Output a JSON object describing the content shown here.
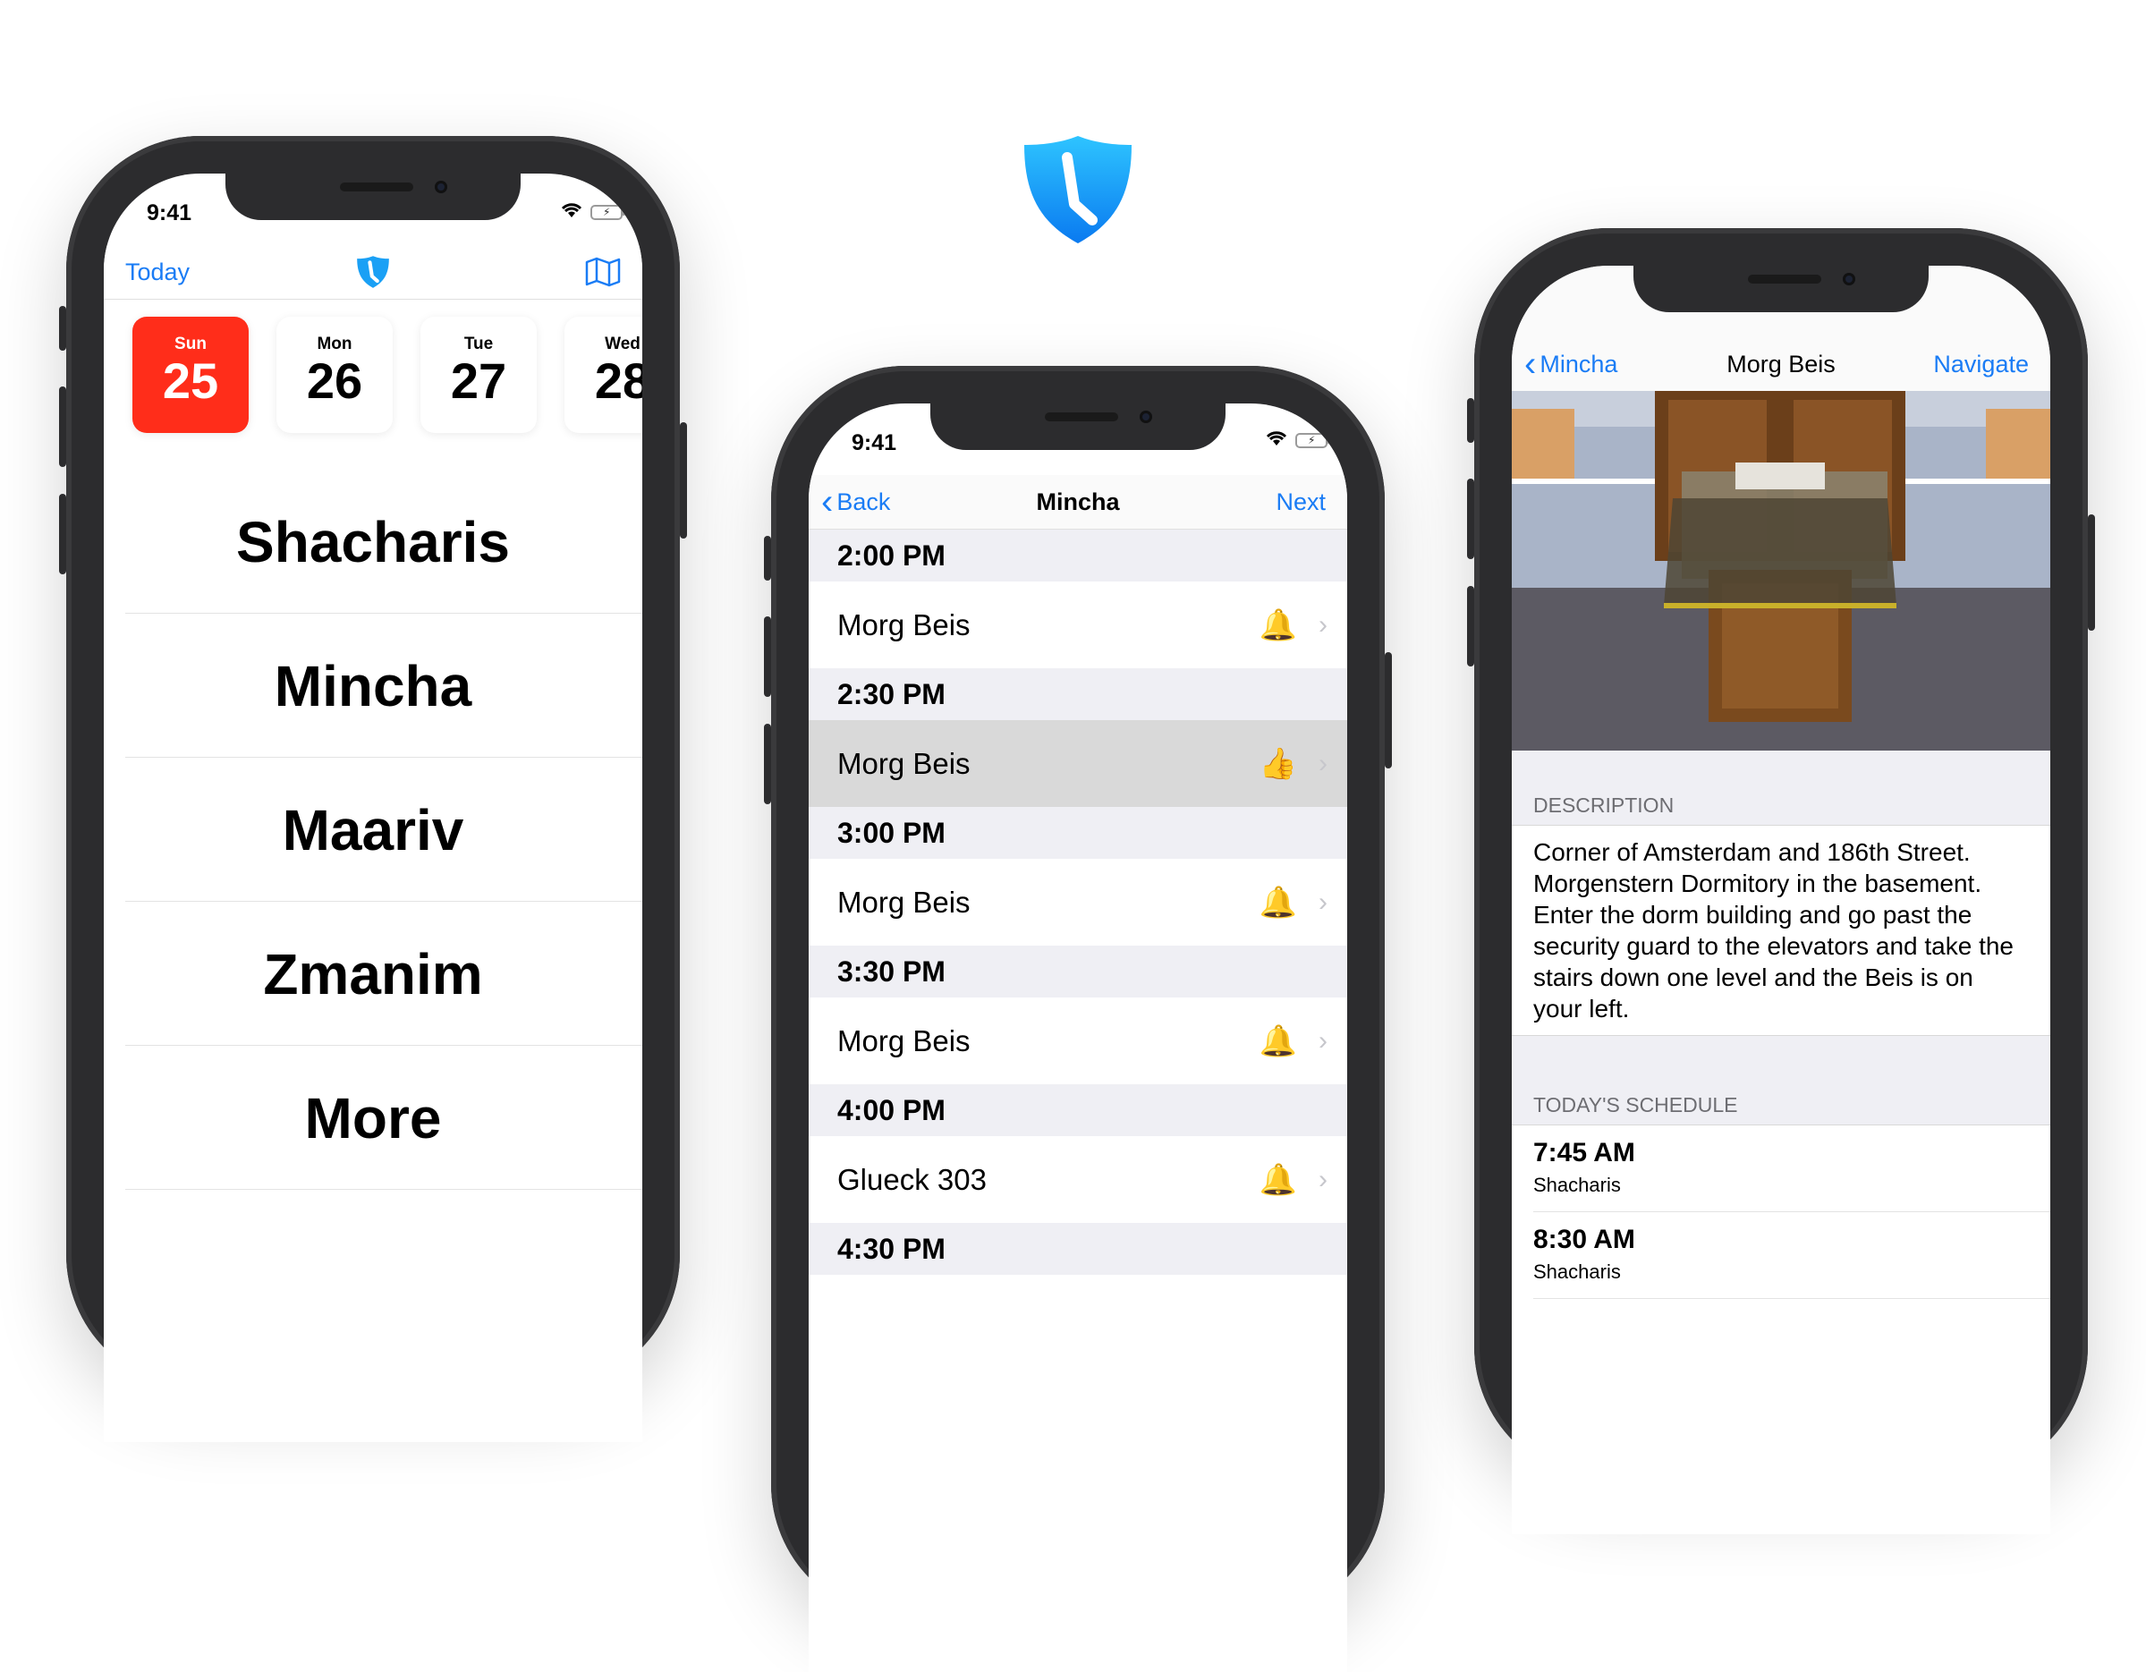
{
  "status": {
    "time": "9:41"
  },
  "phone1": {
    "nav": {
      "left": "Today",
      "center_icon": "shield-clock-icon",
      "right_icon": "map-icon"
    },
    "days": [
      {
        "name": "Sun",
        "num": "25",
        "active": true
      },
      {
        "name": "Mon",
        "num": "26"
      },
      {
        "name": "Tue",
        "num": "27"
      },
      {
        "name": "Wed",
        "num": "28"
      }
    ],
    "menu": [
      "Shacharis",
      "Mincha",
      "Maariv",
      "Zmanim",
      "More"
    ]
  },
  "phone2": {
    "nav": {
      "back": "Back",
      "title": "Mincha",
      "next": "Next"
    },
    "rows": [
      {
        "type": "header",
        "text": "2:00 PM"
      },
      {
        "type": "cell",
        "text": "Morg Beis",
        "icon": "🔔"
      },
      {
        "type": "header",
        "text": "2:30 PM"
      },
      {
        "type": "cell",
        "text": "Morg Beis",
        "icon": "👍",
        "selected": true
      },
      {
        "type": "header",
        "text": "3:00 PM"
      },
      {
        "type": "cell",
        "text": "Morg Beis",
        "icon": "🔔"
      },
      {
        "type": "header",
        "text": "3:30 PM"
      },
      {
        "type": "cell",
        "text": "Morg Beis",
        "icon": "🔔"
      },
      {
        "type": "header",
        "text": "4:00 PM"
      },
      {
        "type": "cell",
        "text": "Glueck 303",
        "icon": "🔔"
      },
      {
        "type": "header",
        "text": "4:30 PM"
      }
    ]
  },
  "phone3": {
    "nav": {
      "back": "Mincha",
      "title": "Morg Beis",
      "right": "Navigate"
    },
    "description_header": "DESCRIPTION",
    "description": "Corner of Amsterdam and 186th Street. Morgenstern Dormitory in the basement. Enter the dorm building and go past the security guard to the elevators and take the stairs down one level and the Beis is on your left.",
    "schedule_header": "TODAY'S SCHEDULE",
    "schedule": [
      {
        "time": "7:45 AM",
        "service": "Shacharis"
      },
      {
        "time": "8:30 AM",
        "service": "Shacharis"
      }
    ]
  },
  "colors": {
    "accent": "#1a7cf5",
    "today": "#ff2d1a",
    "logo": "#1aa0f5"
  }
}
